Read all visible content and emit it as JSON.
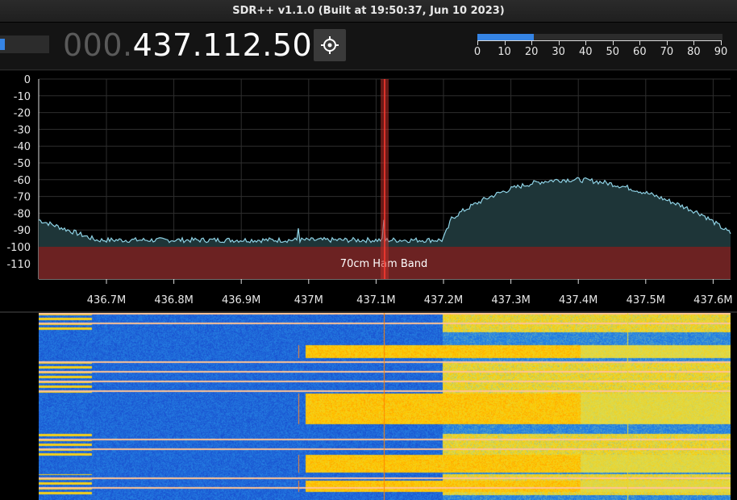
{
  "window": {
    "title": "SDR++ v1.1.0 (Built at 19:50:37, Jun 10 2023)"
  },
  "toolbar": {
    "frequency_dim": "000.",
    "frequency_bright": "437.112.500",
    "snr_meter": {
      "value": 21,
      "max": 90,
      "ticks": [
        "0",
        "10",
        "20",
        "30",
        "40",
        "50",
        "60",
        "70",
        "80",
        "90"
      ]
    }
  },
  "fft": {
    "y_ticks": [
      "0",
      "-10",
      "-20",
      "-30",
      "-40",
      "-50",
      "-60",
      "-70",
      "-80",
      "-90",
      "-100",
      "-110"
    ],
    "x_ticks": [
      "436.7M",
      "436.8M",
      "436.9M",
      "437M",
      "437.1M",
      "437.2M",
      "437.3M",
      "437.4M",
      "437.5M",
      "437.6M"
    ],
    "band_label": "70cm Ham Band",
    "colors": {
      "trace": "#8fd3e6",
      "fill": "#1e3538",
      "band": "#7a1e1e",
      "vfo": "#c0302a",
      "grid": "#2e2e2e"
    }
  }
}
